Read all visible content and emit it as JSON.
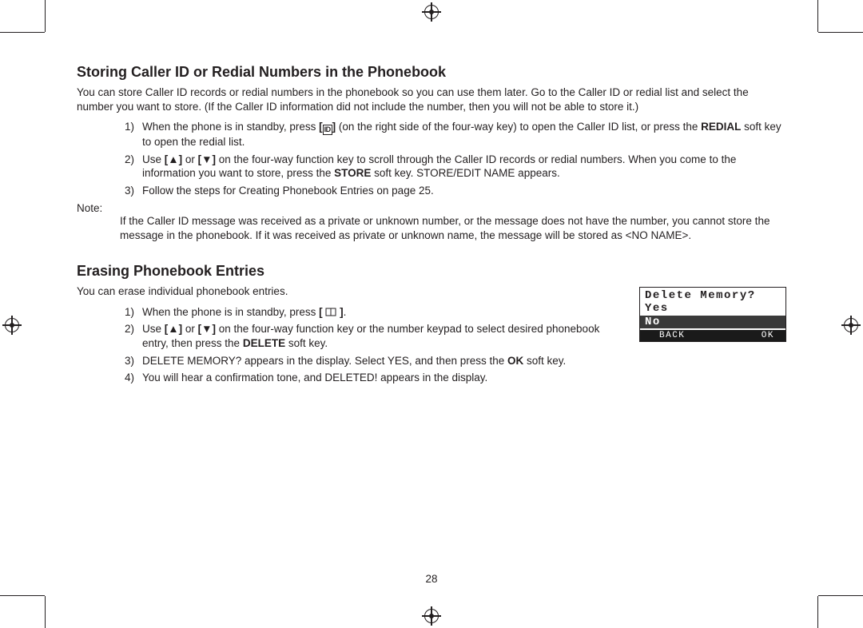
{
  "page_number": "28",
  "section1": {
    "heading": "Storing Caller ID or Redial Numbers in the Phonebook",
    "intro": "You can store Caller ID records or redial numbers in the phonebook so you can use them later. Go to the Caller ID or redial list and select the number you want to store. (If the Caller ID information did not include the number, then you will not be able to store it.)",
    "step1_a": "When the phone is in standby, press ",
    "step1_b": " (on the right side of the four-way key) to open the Caller ID list, or press the ",
    "step1_c": "REDIAL",
    "step1_d": " soft key to open the redial list.",
    "step2_a": "Use ",
    "step2_b": " or ",
    "step2_c": " on the four-way function key to scroll through the Caller ID records or redial numbers. When you come to the information you want to store, press the ",
    "step2_d": "STORE",
    "step2_e": " soft key. STORE/EDIT NAME appears.",
    "step3": "Follow the steps for Creating Phonebook Entries on page 25.",
    "note_label": "Note:",
    "note_body": "If the Caller ID message was received as a private or unknown number, or the message does not have the number, you cannot store the message in the phonebook. If it was received as private or unknown name, the message will be stored as <NO NAME>."
  },
  "section2": {
    "heading": "Erasing Phonebook Entries",
    "intro": "You can erase individual phonebook entries.",
    "step1_a": "When the phone is in standby, press ",
    "step1_b": ".",
    "step2_a": "Use ",
    "step2_b": " or ",
    "step2_c": " on the four-way function key or the number keypad to select de­sired phonebook entry, then press the ",
    "step2_d": "DELETE",
    "step2_e": " soft key.",
    "step3_a": "DELETE MEMORY? appears in the display. Select YES, and then press the ",
    "step3_b": "OK",
    "step3_c": " soft key.",
    "step4": "You will hear a confirmation tone, and DELETED! appears in the display."
  },
  "lcd": {
    "line1": "Delete Memory?",
    "line2": "Yes",
    "line3": "No",
    "soft_left": "BACK",
    "soft_right": "OK"
  },
  "icons": {
    "cid": "ID",
    "up": "▲",
    "down": "▼",
    "book": "📖"
  },
  "nums": {
    "n1": "1)",
    "n2": "2)",
    "n3": "3)",
    "n4": "4)"
  }
}
